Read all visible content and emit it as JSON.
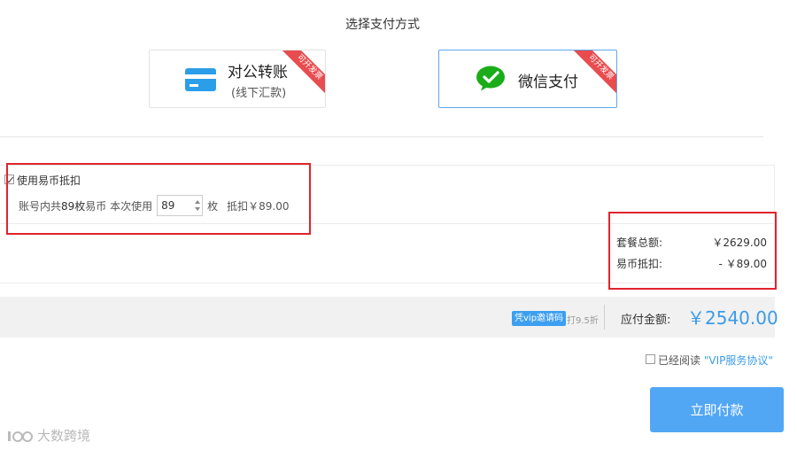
{
  "page_title": "选择支付方式",
  "payment_methods": [
    {
      "label": "对公转账",
      "sublabel": "(线下汇款)",
      "ribbon": "可开发票",
      "icon": "bank-card-icon",
      "selected": false
    },
    {
      "label": "微信支付",
      "ribbon": "可开发票",
      "icon": "wechat-pay-icon",
      "selected": true
    }
  ],
  "coin": {
    "checkbox_label": "使用易币抵扣",
    "balance_prefix": "账号内共",
    "balance_value": "89枚",
    "balance_suffix": "易币 本次使用",
    "input_value": "89",
    "unit": "枚",
    "deduct_text": "抵扣￥89.00"
  },
  "summary": {
    "total_label": "套餐总额:",
    "total_value": "￥2629.00",
    "coin_label": "易币抵扣:",
    "coin_value": "- ￥89.00"
  },
  "payment_bar": {
    "vip_badge": "凭vip邀请码",
    "discount_text": "打9.5折",
    "payable_label": "应付金额:",
    "payable_amount": "￥2540.00"
  },
  "agreement": {
    "prefix": "已经阅读",
    "link": "\"VIP服务协议\""
  },
  "pay_button": "立即付款",
  "watermark": "大数跨境",
  "colors": {
    "accent": "#3b9be8",
    "button": "#52a7f4",
    "ribbon": "#e84c4f",
    "highlight_box": "#e0242c",
    "wechat_green": "#1aad19"
  }
}
